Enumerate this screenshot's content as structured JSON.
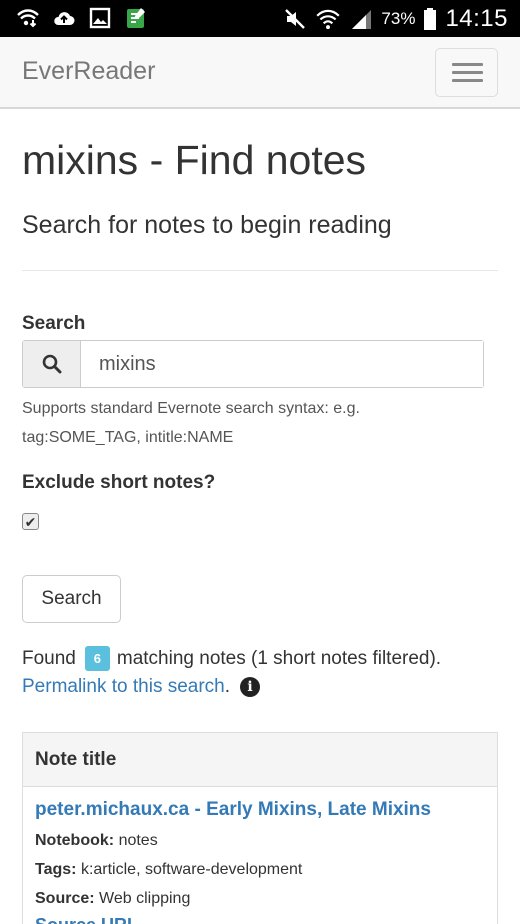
{
  "status_bar": {
    "battery_percent": "73%",
    "time": "14:15",
    "icons": [
      "wifi-download-icon",
      "cloud-upload-icon",
      "image-icon",
      "sim-app-icon",
      "mute-icon",
      "wifi-icon",
      "signal-icon",
      "battery-icon"
    ]
  },
  "navbar": {
    "brand": "EverReader",
    "toggle_icon": "hamburger-menu-icon"
  },
  "page": {
    "title": "mixins - Find notes",
    "subtitle": "Search for notes to begin reading"
  },
  "search": {
    "label": "Search",
    "icon": "search-icon",
    "value": "mixins",
    "help_line1": "Supports standard Evernote search syntax: e.g.",
    "help_line2": "tag:SOME_TAG, intitle:NAME"
  },
  "exclude": {
    "label": "Exclude short notes?",
    "checked": true
  },
  "search_button": "Search",
  "results": {
    "found_prefix": "Found",
    "count": "6",
    "found_suffix": "matching notes (1 short notes filtered).",
    "permalink": "Permalink to this search",
    "permalink_suffix": ".",
    "info_icon": "info-icon"
  },
  "table": {
    "header": "Note title",
    "rows": [
      {
        "title": "peter.michaux.ca - Early Mixins, Late Mixins",
        "notebook_label": "Notebook:",
        "notebook": "notes",
        "tags_label": "Tags:",
        "tags": "k:article, software-development",
        "source_label": "Source:",
        "source": "Web clipping",
        "source_url": "Source URL"
      }
    ]
  },
  "colors": {
    "link": "#337ab7",
    "badge": "#5bc0de",
    "navbar_bg": "#f8f8f8",
    "status_bg": "#000000"
  }
}
